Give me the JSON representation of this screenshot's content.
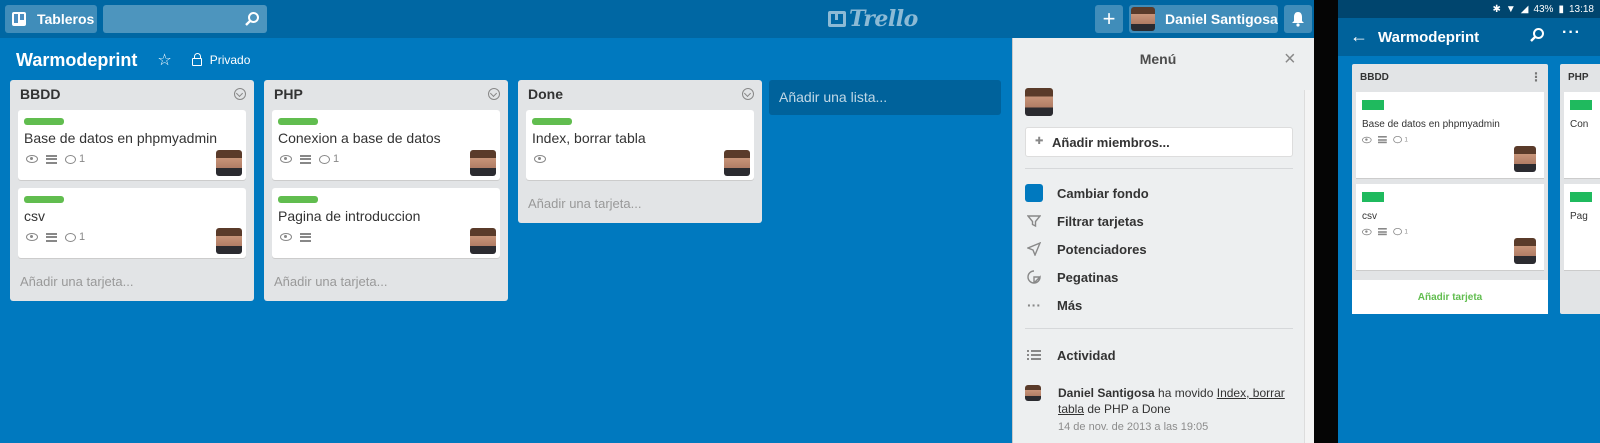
{
  "desktop": {
    "header": {
      "boards_label": "Tableros",
      "search_placeholder": "",
      "logo_text": "Trello",
      "add_label": "+",
      "user_name": "Daniel Santigosa"
    },
    "board": {
      "title": "Warmodeprint",
      "privacy": "Privado"
    },
    "lists": [
      {
        "name": "BBDD",
        "cards": [
          {
            "title": "Base de datos en phpmyadmin",
            "comments": "1"
          },
          {
            "title": "csv",
            "comments": "1"
          }
        ],
        "add_card": "Añadir una tarjeta..."
      },
      {
        "name": "PHP",
        "cards": [
          {
            "title": "Conexion a base de datos",
            "comments": "1"
          },
          {
            "title": "Pagina de introduccion",
            "comments": ""
          }
        ],
        "add_card": "Añadir una tarjeta..."
      },
      {
        "name": "Done",
        "cards": [
          {
            "title": "Index, borrar tabla",
            "comments": ""
          }
        ],
        "add_card": "Añadir una tarjeta..."
      }
    ],
    "add_list": "Añadir una lista...",
    "label_color": "#61bd4f",
    "background_color": "#0079bf"
  },
  "menu": {
    "title": "Menú",
    "close_icon": "×",
    "add_members": "Añadir miembros...",
    "items": [
      {
        "icon": "background-swatch",
        "label": "Cambiar fondo"
      },
      {
        "icon": "filter-icon",
        "label": "Filtrar tarjetas"
      },
      {
        "icon": "rocket-icon",
        "label": "Potenciadores"
      },
      {
        "icon": "sticker-icon",
        "label": "Pegatinas"
      },
      {
        "icon": "more-icon",
        "label": "Más"
      }
    ],
    "activity_title": "Actividad",
    "activity": {
      "user": "Daniel Santigosa",
      "action": " ha movido ",
      "card": "Index, borrar tabla",
      "detail": " de PHP a Done",
      "date": "14 de nov. de 2013 a las 19:05"
    }
  },
  "mobile": {
    "status": {
      "battery": "43%",
      "time": "13:18"
    },
    "title": "Warmodeprint",
    "list": {
      "name": "BBDD",
      "cards": [
        {
          "title": "Base de datos en phpmyadmin",
          "comments": "1"
        },
        {
          "title": "csv",
          "comments": "1"
        }
      ],
      "add_card": "Añadir tarjeta"
    },
    "second_list": {
      "name": "PHP",
      "peek_texts": [
        "Con",
        "Pag"
      ]
    },
    "label_color": "#1fba5e"
  }
}
